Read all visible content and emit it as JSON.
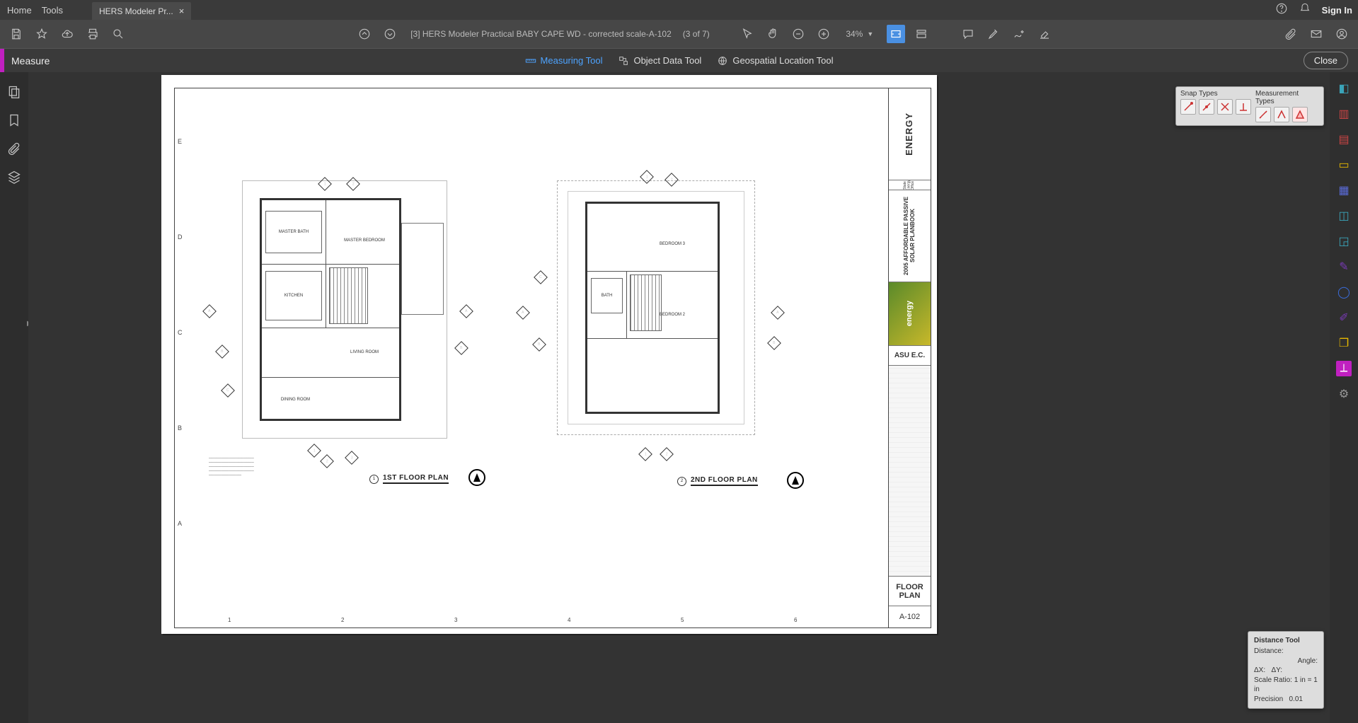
{
  "menubar": {
    "home": "Home",
    "tools": "Tools"
  },
  "tab": {
    "title": "HERS Modeler Pr..."
  },
  "topright": {
    "signin": "Sign In"
  },
  "toolbar": {
    "docname": "[3] HERS Modeler Practical BABY CAPE WD - corrected scale-A-102",
    "pageinfo": "(3 of 7)",
    "zoom": "34%"
  },
  "measurebar": {
    "label": "Measure",
    "measuring": "Measuring Tool",
    "objectdata": "Object Data Tool",
    "geo": "Geospatial Location Tool",
    "close": "Close"
  },
  "snap": {
    "snaptitle": "Snap Types",
    "meastitle": "Measurement Types"
  },
  "dist": {
    "title": "Distance Tool",
    "distance": "Distance:",
    "angle": "Angle:",
    "dx": "ΔX:",
    "dy": "ΔY:",
    "scale": "Scale Ratio:",
    "scaleval": "1 in = 1 in",
    "prec": "Precision",
    "precval": "0.01"
  },
  "titleblock": {
    "project": "2005 AFFORDABLE PASSIVE SOLAR PLANBOOK",
    "client": "ASU E.C.",
    "sheet_title": "FLOOR PLAN",
    "sheet_no": "A-102",
    "logo1": "ENERGY",
    "logo1_sub": "State Energy Office"
  },
  "plans": {
    "first": {
      "title": "1ST FLOOR PLAN",
      "rooms": {
        "master": "MASTER BEDROOM",
        "mbath": "MASTER BATH",
        "kitchen": "KITCHEN",
        "living": "LIVING ROOM",
        "dining": "DINING ROOM"
      }
    },
    "second": {
      "title": "2ND FLOOR PLAN",
      "rooms": {
        "bed3": "BEDROOM 3",
        "bed2": "BEDROOM 2",
        "bath": "BATH"
      }
    }
  },
  "grid": {
    "rows": [
      "E",
      "D",
      "C",
      "B",
      "A"
    ],
    "cols": [
      "1",
      "2",
      "3",
      "4",
      "5",
      "6"
    ]
  }
}
